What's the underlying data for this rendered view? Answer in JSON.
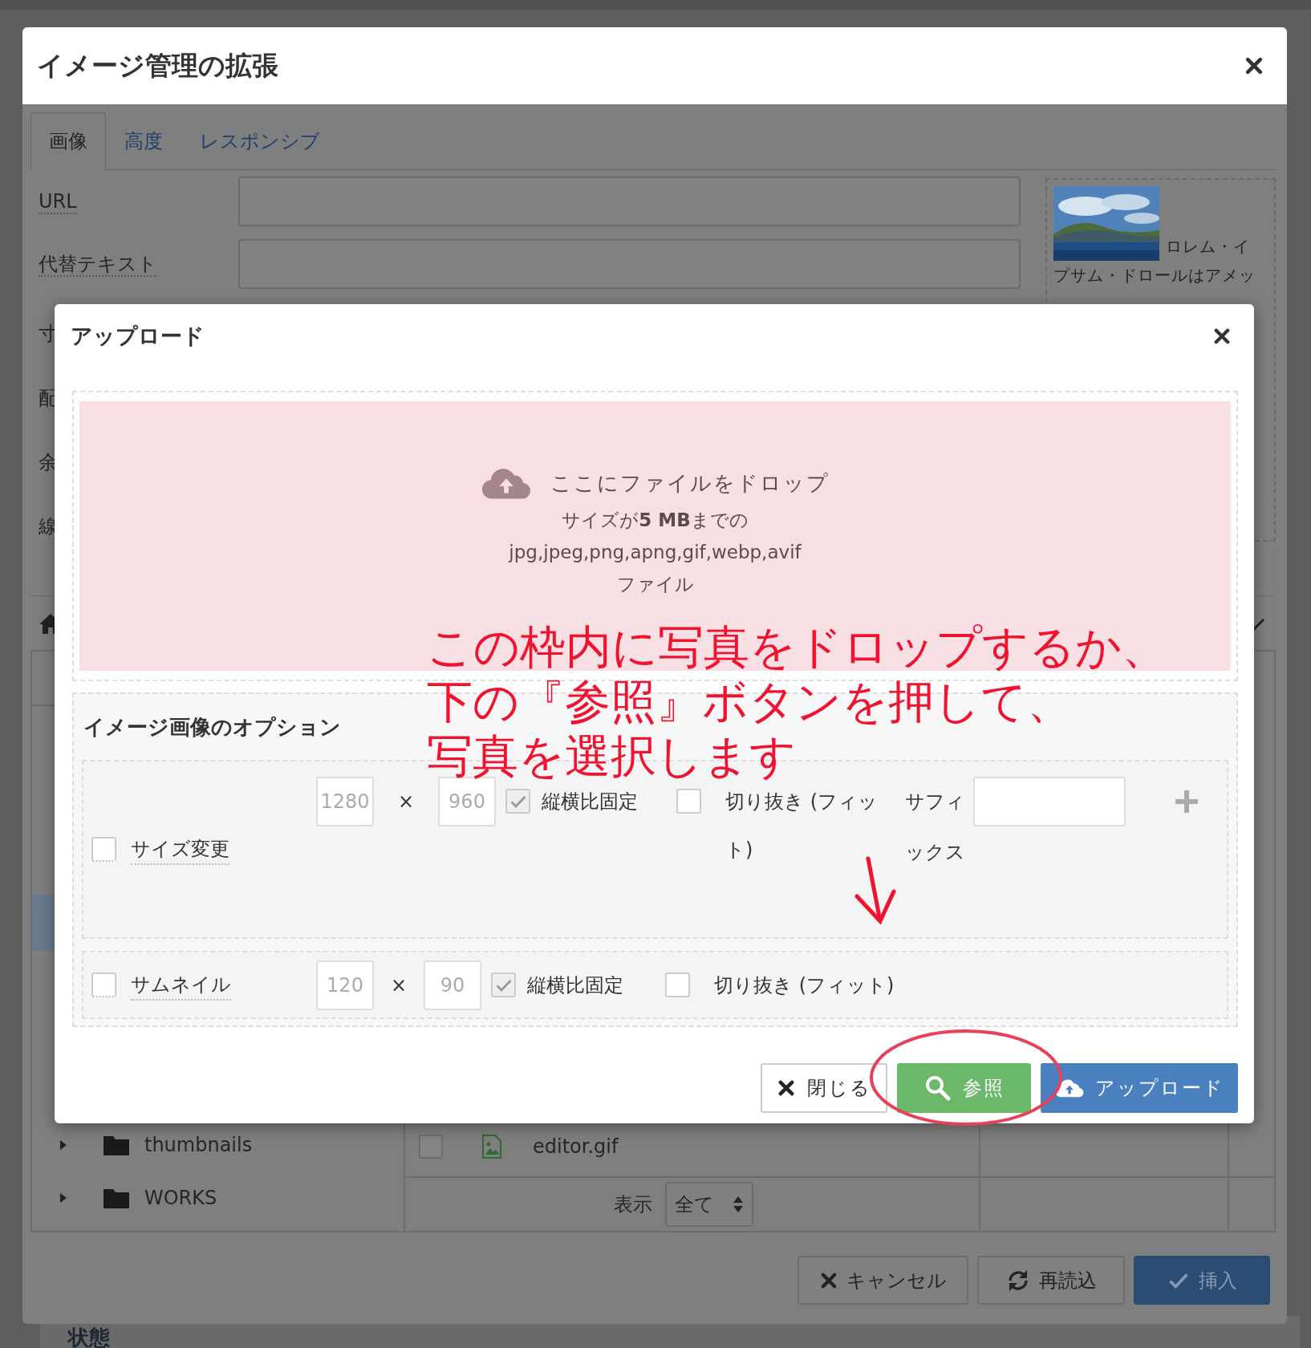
{
  "window": {
    "title": "イメージ管理の拡張"
  },
  "tabs": [
    {
      "label": "画像",
      "selected": true
    },
    {
      "label": "高度",
      "selected": false
    },
    {
      "label": "レスポンシブ",
      "selected": false
    }
  ],
  "fields": [
    {
      "label": "URL"
    },
    {
      "label": "代替テキスト"
    }
  ],
  "partial_labels": [
    "寸",
    "配",
    "余",
    "線"
  ],
  "preview": {
    "kind": "picture",
    "caption_lines": [
      "ロレム・イ",
      "プサム・ドロールはアメッ"
    ]
  },
  "folders": [
    {
      "name": "thumbnails",
      "expanded": false
    },
    {
      "name": "WORKS",
      "expanded": false
    }
  ],
  "files": [
    {
      "name": "editor.gif",
      "checked": false
    }
  ],
  "filter": {
    "label": "表示",
    "value": "全て"
  },
  "footer_buttons": [
    {
      "label": "キャンセル",
      "kind": "cancel"
    },
    {
      "label": "再読込",
      "kind": "reload"
    },
    {
      "label": "挿入",
      "kind": "insert"
    }
  ],
  "status_heading": "状態",
  "upload_dialog": {
    "title": "アップロード",
    "drop": {
      "heading": "ここにファイルをドロップ",
      "size_note": "サイズが**5 MB**までの",
      "types": "jpg,jpeg,png,apng,gif,webp,avif",
      "suffix": "ファイル"
    },
    "options_title": "イメージ画像のオプション",
    "options": [
      {
        "kind": "resize",
        "label": "サイズ変更",
        "checked": false,
        "width_placeholder": "1280",
        "height_placeholder": "960",
        "times": "×",
        "aspect_label": "縦横比固定",
        "aspect_checked": true,
        "crop_label": "切り抜き (フィット)",
        "crop_checked": false,
        "suffix_label": "サフィックス"
      },
      {
        "kind": "thumbnail",
        "label": "サムネイル",
        "checked": false,
        "width_placeholder": "120",
        "height_placeholder": "90",
        "times": "×",
        "aspect_label": "縦横比固定",
        "aspect_checked": true,
        "crop_label": "切り抜き (フィット)",
        "crop_checked": false
      }
    ],
    "buttons": [
      {
        "label": "閉じる",
        "kind": "close"
      },
      {
        "label": "参照",
        "kind": "browse"
      },
      {
        "label": "アップロード",
        "kind": "upload"
      }
    ]
  },
  "annotation": {
    "lines": [
      "この枠内に写真をドロップするか、",
      "下の『参照』ボタンを押して、",
      "写真を選択します"
    ]
  }
}
